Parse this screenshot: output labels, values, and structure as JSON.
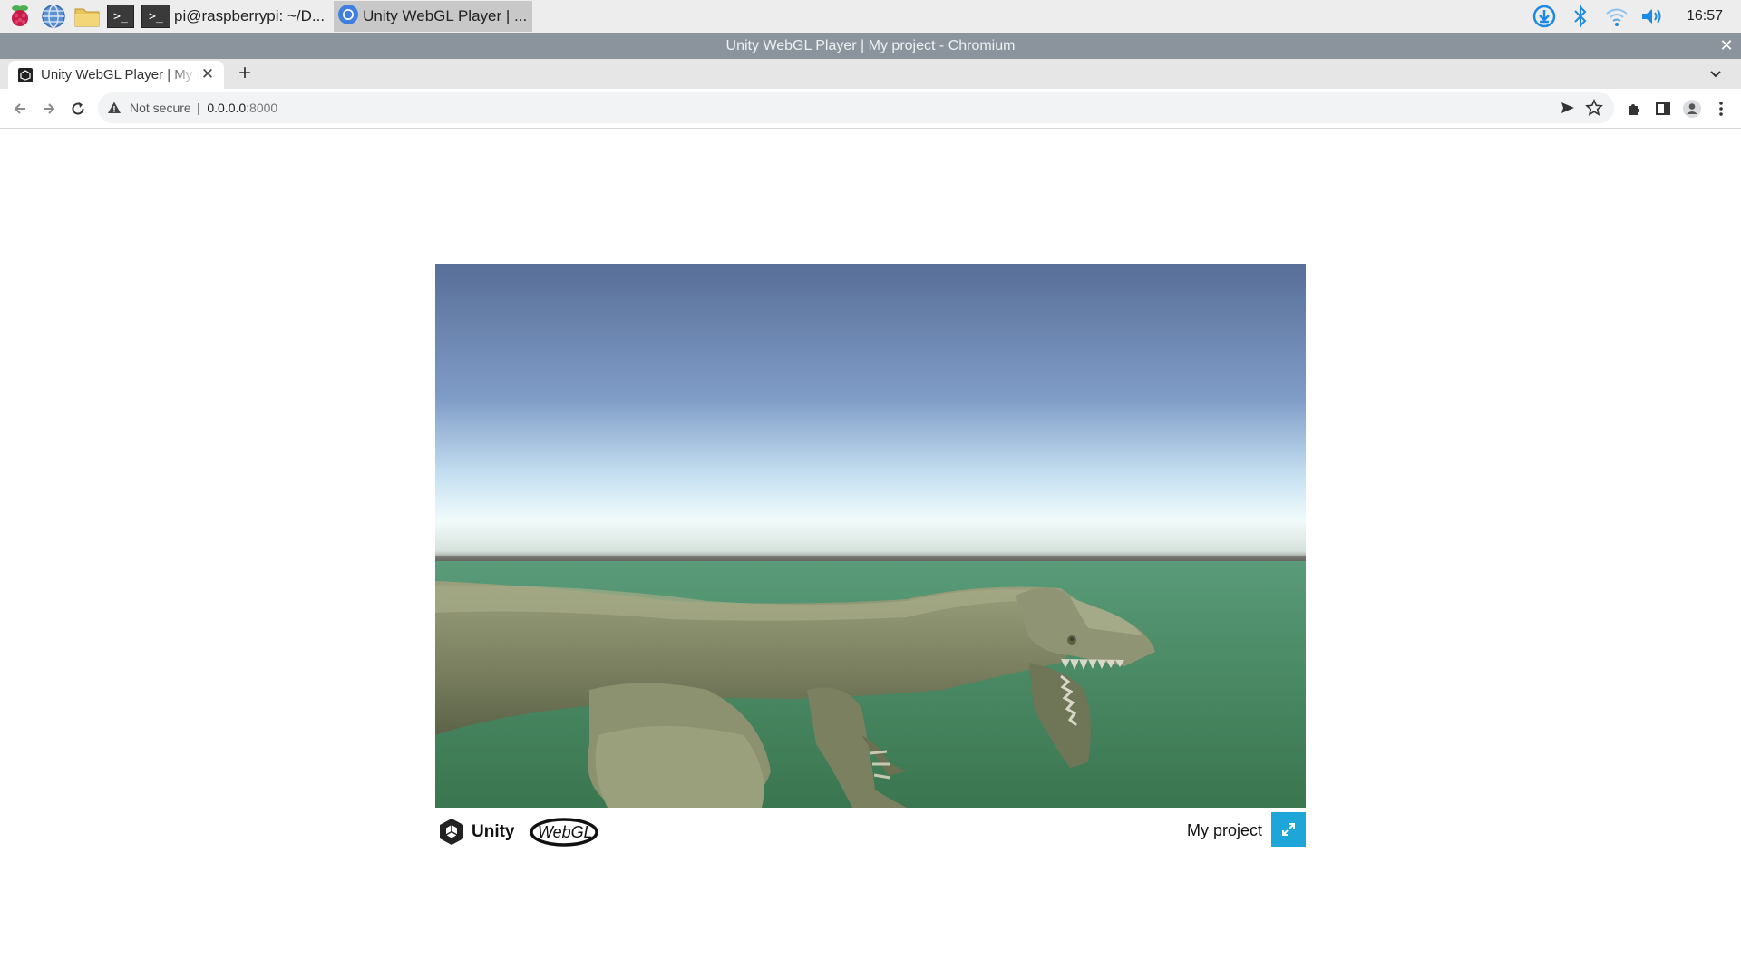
{
  "taskbar": {
    "tasks": [
      {
        "label": "pi@raspberrypi: ~/D..."
      },
      {
        "label": "Unity WebGL Player | ..."
      }
    ],
    "clock": "16:57"
  },
  "window": {
    "title": "Unity WebGL Player | My project - Chromium"
  },
  "browser": {
    "tab_title": "Unity WebGL Player | My project",
    "security_label": "Not secure",
    "url_host": "0.0.0.0",
    "url_port": ":8000"
  },
  "unity": {
    "build_title": "My project",
    "logo_unity": "Unity",
    "logo_webgl": "WebGL"
  },
  "colors": {
    "accent_fullscreen": "#1fa6d9",
    "titlebar": "#8b949c",
    "sky_top": "#586f98",
    "ground": "#3e7a52"
  }
}
